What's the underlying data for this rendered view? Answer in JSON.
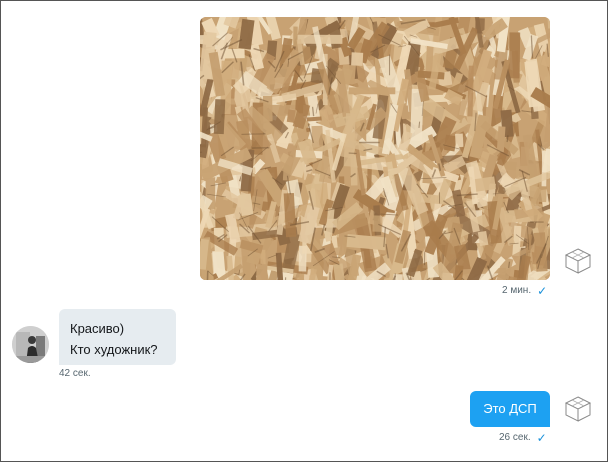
{
  "conversation": {
    "messages": [
      {
        "direction": "outgoing",
        "type": "image",
        "image_desc": "osb-board-photo",
        "time": "2 мин.",
        "status_icon": "check-icon"
      },
      {
        "direction": "incoming",
        "type": "text",
        "lines": [
          "Красиво)",
          "Кто художник?"
        ],
        "time": "42 сек.",
        "avatar": "user-avatar"
      },
      {
        "direction": "outgoing",
        "type": "text",
        "text": "Это ДСП",
        "time": "26 сек.",
        "status_icon": "check-icon"
      }
    ]
  },
  "colors": {
    "outgoing_bubble": "#1da1f2",
    "incoming_bubble": "#e6ecf0",
    "check": "#1a91da",
    "meta_text": "#56666f"
  }
}
